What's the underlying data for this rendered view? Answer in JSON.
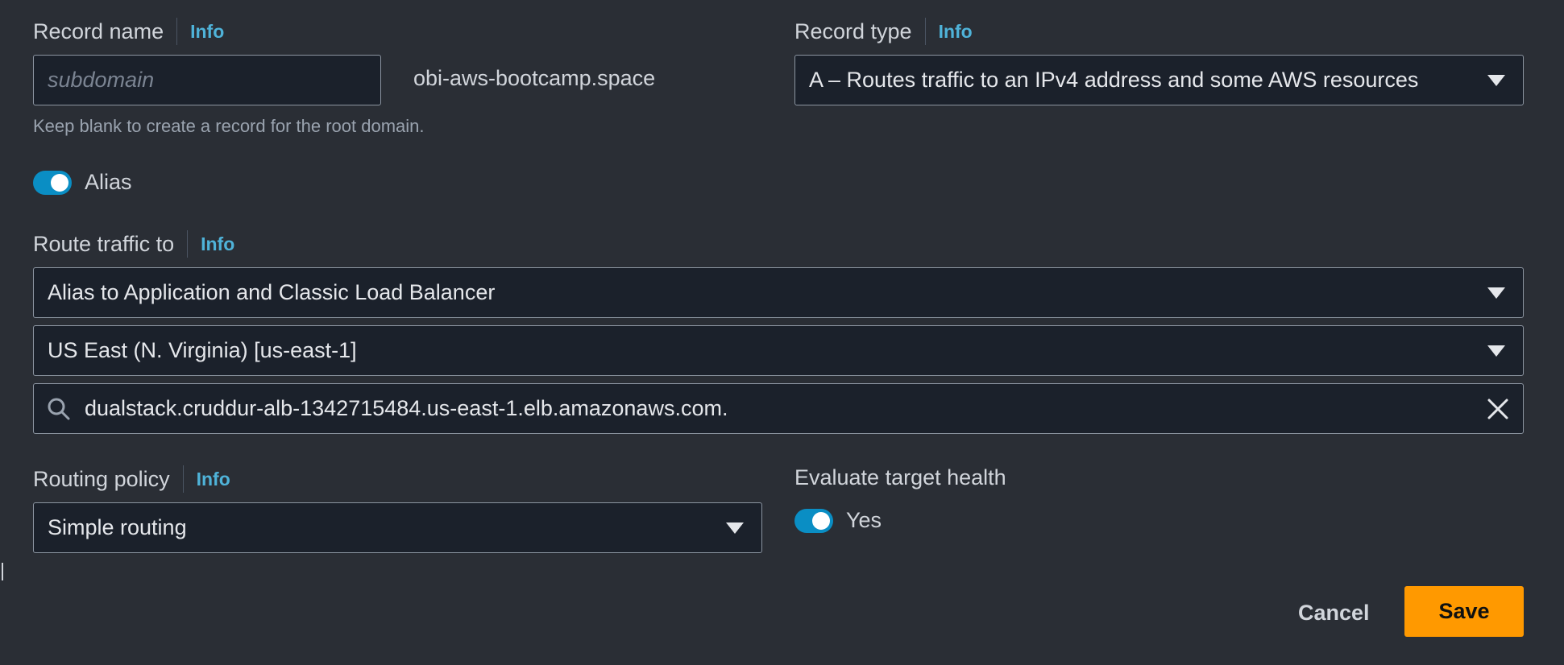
{
  "record_name": {
    "label": "Record name",
    "info": "Info",
    "placeholder": "subdomain",
    "domain_suffix": "obi-aws-bootcamp.space",
    "hint": "Keep blank to create a record for the root domain."
  },
  "record_type": {
    "label": "Record type",
    "info": "Info",
    "value": "A – Routes traffic to an IPv4 address and some AWS resources"
  },
  "alias": {
    "label": "Alias",
    "enabled": true
  },
  "route_traffic": {
    "label": "Route traffic to",
    "info": "Info",
    "endpoint_type": "Alias to Application and Classic Load Balancer",
    "region": "US East (N. Virginia) [us-east-1]",
    "load_balancer": "dualstack.cruddur-alb-1342715484.us-east-1.elb.amazonaws.com."
  },
  "routing_policy": {
    "label": "Routing policy",
    "info": "Info",
    "value": "Simple routing"
  },
  "evaluate_health": {
    "label": "Evaluate target health",
    "toggle_label": "Yes",
    "enabled": true
  },
  "actions": {
    "cancel_label": "Cancel",
    "save_label": "Save"
  },
  "colors": {
    "background": "#2a2e35",
    "field_background": "#1b212b",
    "info_link": "#4fb3d9",
    "toggle_on": "#0a8ec4",
    "primary_button": "#ff9900"
  },
  "icons": [
    "search-icon",
    "clear-icon",
    "caret-down-icon"
  ]
}
